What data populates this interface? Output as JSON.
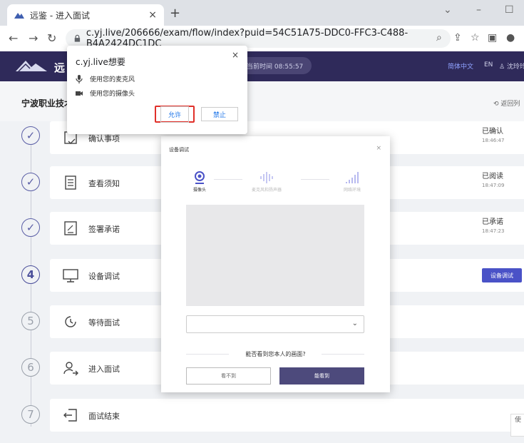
{
  "browser": {
    "tab_title": "远鉴 - 进入面试",
    "tab_close": "×",
    "new_tab": "+",
    "url": "c.yj.live/206666/exam/flow/index?puid=54C51A75-DDC0-FFC3-C488-B4A2424DC1DC"
  },
  "header": {
    "brand": "远",
    "current_time": "当前时间 08:55:57",
    "lang_cn": "简体中文",
    "lang_en": "EN",
    "user": "沈玲玲"
  },
  "subbar": {
    "org": "宁波职业技术",
    "back": "返回列"
  },
  "steps": [
    {
      "num": "✓",
      "label": "确认事项",
      "status": "已确认",
      "time": "18:46:47"
    },
    {
      "num": "✓",
      "label": "查看须知",
      "status": "已阅读",
      "time": "18:47:09"
    },
    {
      "num": "✓",
      "label": "签署承诺",
      "status": "已承诺",
      "time": "18:47:23"
    },
    {
      "num": "4",
      "label": "设备调试",
      "button": "设备调试"
    },
    {
      "num": "5",
      "label": "等待面试"
    },
    {
      "num": "6",
      "label": "进入面试"
    },
    {
      "num": "7",
      "label": "面试结束"
    }
  ],
  "dialog": {
    "title": "设备调试",
    "close": "×",
    "step1": "摄像头",
    "step2": "麦克风和扬声器",
    "step3": "网络环境",
    "question": "能否看到您本人的画面?",
    "btn_no": "看不到",
    "btn_yes": "能看到"
  },
  "permission": {
    "site": "c.yj.live想要",
    "close": "×",
    "mic": "使用您的麦克风",
    "camera": "使用您的摄像头",
    "allow": "允许",
    "block": "禁止"
  },
  "help": {
    "label": "使"
  }
}
